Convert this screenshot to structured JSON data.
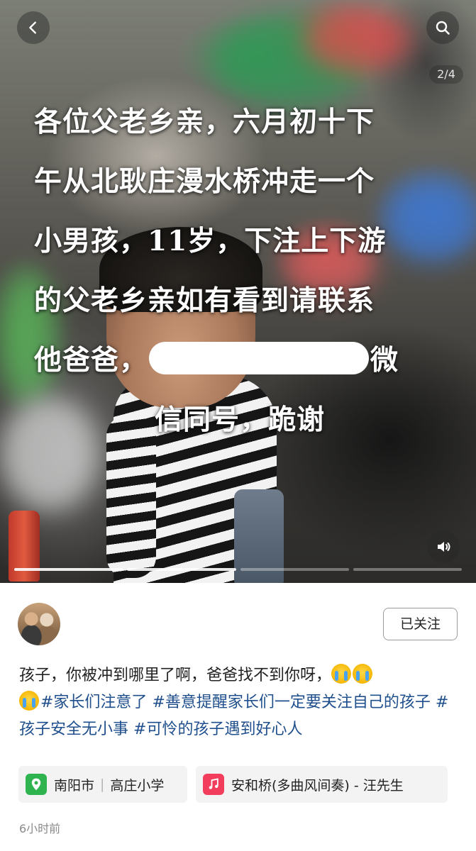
{
  "media": {
    "counter": "2/4",
    "overlay_lines": [
      "各位父老乡亲，六月初十下",
      "午从北耿庄漫水桥冲走一个",
      "小男孩，11岁，下注上下游",
      "的父老乡亲如有看到请联系"
    ],
    "line5_prefix": "他爸爸，",
    "line5_suffix": "微",
    "line6": "信同号，跪谢",
    "progress": {
      "total_segments": 4,
      "current_segment": 2
    },
    "icons": {
      "back": "back-arrow-icon",
      "search": "search-icon",
      "sound": "speaker-icon"
    }
  },
  "post": {
    "follow_label": "已关注",
    "desc_text": "孩子，你被冲到哪里了啊，爸爸找不到你呀，",
    "tags": [
      "#家长们注意了",
      "#善意提醒家长们一定要关注自己的孩子",
      "#孩子安全无小事",
      "#可怜的孩子遇到好心人"
    ],
    "location": {
      "city": "南阳市",
      "place": "高庄小学"
    },
    "music": "安和桥(多曲风间奏) - 汪先生",
    "time": "6小时前"
  },
  "colors": {
    "tag": "#1f4f8c",
    "location_icon": "#2fb34f",
    "music_icon": "#f23d5c"
  }
}
